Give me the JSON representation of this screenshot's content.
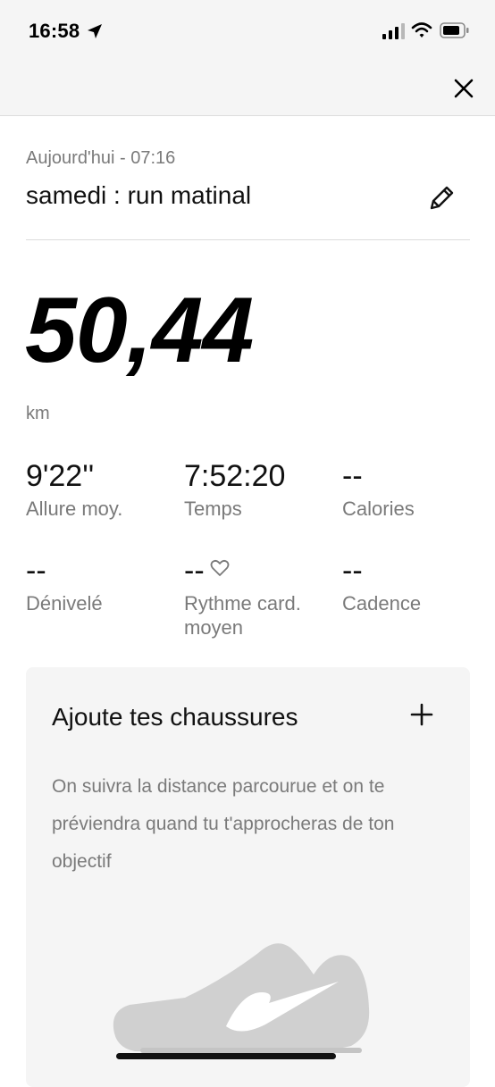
{
  "status_bar": {
    "time": "16:58"
  },
  "activity": {
    "date_line": "Aujourd'hui - 07:16",
    "title": "samedi : run matinal",
    "distance": "50,44",
    "unit": "km"
  },
  "stats": [
    {
      "value": "9'22''",
      "label": "Allure moy."
    },
    {
      "value": "7:52:20",
      "label": "Temps"
    },
    {
      "value": "--",
      "label": "Calories"
    },
    {
      "value": "--",
      "label": "Dénivelé"
    },
    {
      "value": "--",
      "label": "Rythme card. moyen"
    },
    {
      "value": "--",
      "label": "Cadence"
    }
  ],
  "shoes_card": {
    "title": "Ajoute tes chaussures",
    "description": "On suivra la distance parcourue et on te préviendra quand tu t'approcheras de ton objectif"
  },
  "colors": {
    "background": "#ffffff",
    "header_background": "#f5f5f5",
    "card_background": "#f5f5f5",
    "muted_text": "#7a7a7a",
    "primary_text": "#111111",
    "shoe_gray": "#d0d0d0"
  },
  "icons": [
    "location-arrow-icon",
    "signal-icon",
    "wifi-icon",
    "battery-icon",
    "close-icon",
    "pencil-icon",
    "heart-icon",
    "plus-icon",
    "shoe-icon"
  ]
}
